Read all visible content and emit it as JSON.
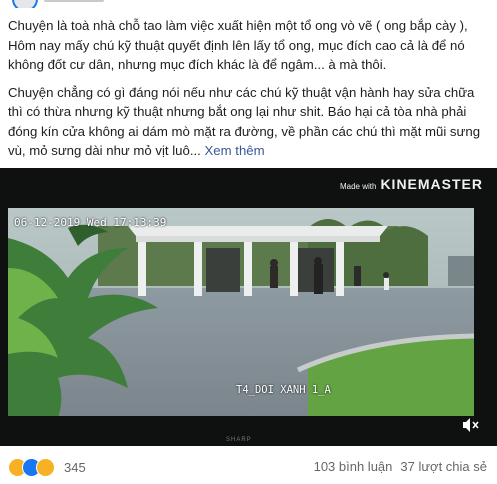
{
  "post": {
    "paragraph1": "Chuyện là toà nhà chỗ tao làm việc xuất hiện một tổ ong vò vẽ ( ong bắp cày ), Hôm nay mấy chú kỹ thuật quyết định lên lấy tổ ong, mục đích cao cả là để nó không đốt cư dân, nhưng mục đích khác là để ngâm... à mà thôi.",
    "paragraph2": "Chuyện chẳng có gì đáng nói nếu như các chú kỹ thuật vận hành hay sửa chữa thì có thừa nhưng kỹ thuật nhưng bắt ong lại như shit. Báo hại cả tòa nhà phải đóng kín cửa không ai dám mò mặt ra đường, về phần các chú thì mặt mũi sưng vù, mỏ sưng dài như mỏ vịt luô...",
    "see_more": "Xem thêm"
  },
  "video": {
    "watermark_made": "Made with",
    "watermark_brand": "KINEMASTER",
    "cam_timestamp": "06-12-2019 Wed 17:13:39",
    "cam_label": "T4_DOI XANH 1_A",
    "volume_icon": "volume-muted-icon"
  },
  "footer": {
    "reaction_icons": [
      "haha",
      "like",
      "sad"
    ],
    "reaction_count": "345",
    "comments": "103 bình luận",
    "shares": "37 lượt chia sẻ"
  },
  "colors": {
    "link": "#385898",
    "meta": "#65676b",
    "like": "#1877f2",
    "haha": "#f7b125"
  }
}
